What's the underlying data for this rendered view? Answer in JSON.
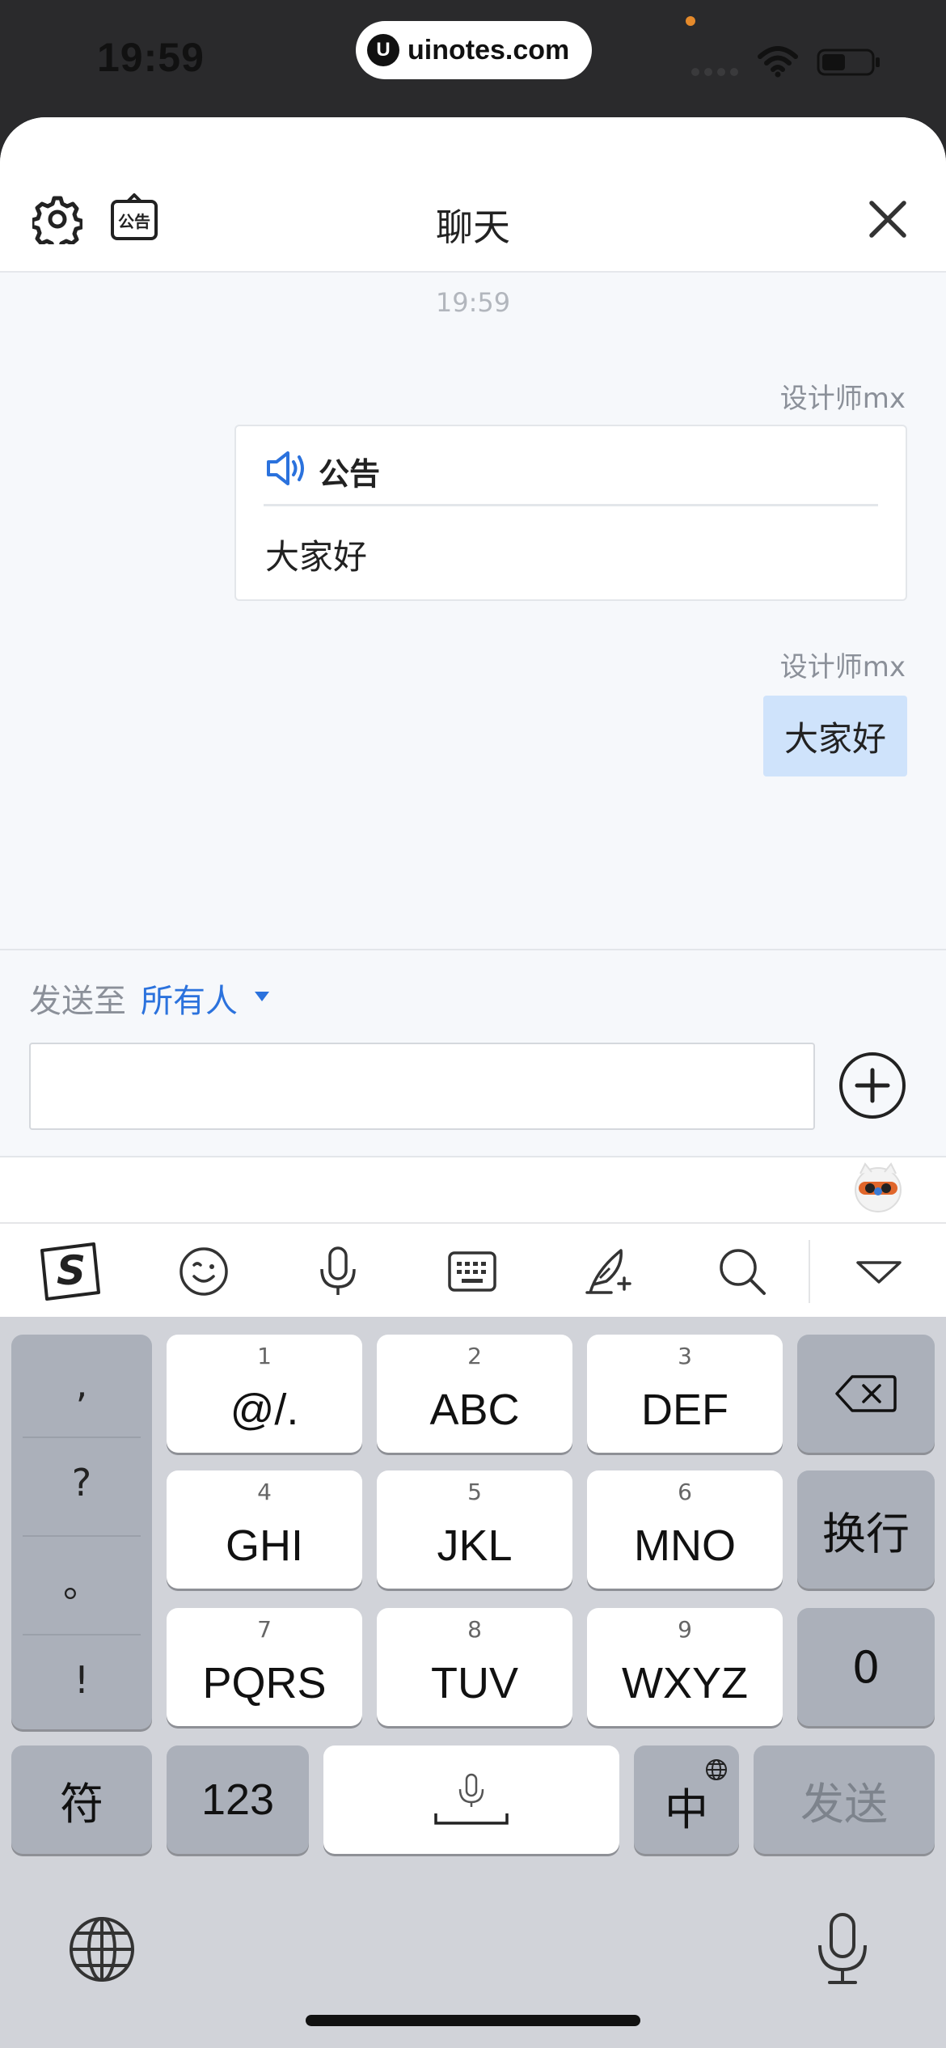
{
  "status_bar": {
    "time": "19:59",
    "url": "uinotes.com",
    "url_logo": "U"
  },
  "header": {
    "title": "聊天",
    "left_icons": [
      "gear-icon",
      "notice-board-icon"
    ],
    "notice_board_text": "公告",
    "right_icon": "close-icon"
  },
  "chat": {
    "timestamp": "19:59",
    "messages": [
      {
        "sender": "设计师mx",
        "type": "notice",
        "notice_label": "公告",
        "body": "大家好"
      },
      {
        "sender": "设计师mx",
        "type": "text",
        "body": "大家好"
      }
    ]
  },
  "composer": {
    "send_to_label": "发送至",
    "send_to_target": "所有人",
    "input_value": "",
    "input_placeholder": ""
  },
  "keyboard_toolbar": {
    "items": [
      "sogou-logo-icon",
      "emoji-icon",
      "microphone-icon",
      "keyboard-icon",
      "handwriting-icon",
      "search-icon",
      "collapse-icon"
    ],
    "logo_letter": "S"
  },
  "keyboard": {
    "punctuation": [
      ",",
      "?",
      "。",
      "!"
    ],
    "keys": [
      {
        "num": "1",
        "label": "@/."
      },
      {
        "num": "2",
        "label": "ABC"
      },
      {
        "num": "3",
        "label": "DEF"
      },
      {
        "num": "4",
        "label": "GHI"
      },
      {
        "num": "5",
        "label": "JKL"
      },
      {
        "num": "6",
        "label": "MNO"
      },
      {
        "num": "7",
        "label": "PQRS"
      },
      {
        "num": "8",
        "label": "TUV"
      },
      {
        "num": "9",
        "label": "WXYZ"
      }
    ],
    "newline_label": "换行",
    "zero_label": "0",
    "symbols_label": "符",
    "numbers_label": "123",
    "lang_label": "中",
    "send_label": "发送"
  },
  "colors": {
    "accent": "#2b72dd",
    "bubble": "#cfe3fb",
    "keyboard_bg": "#d1d3d9"
  }
}
